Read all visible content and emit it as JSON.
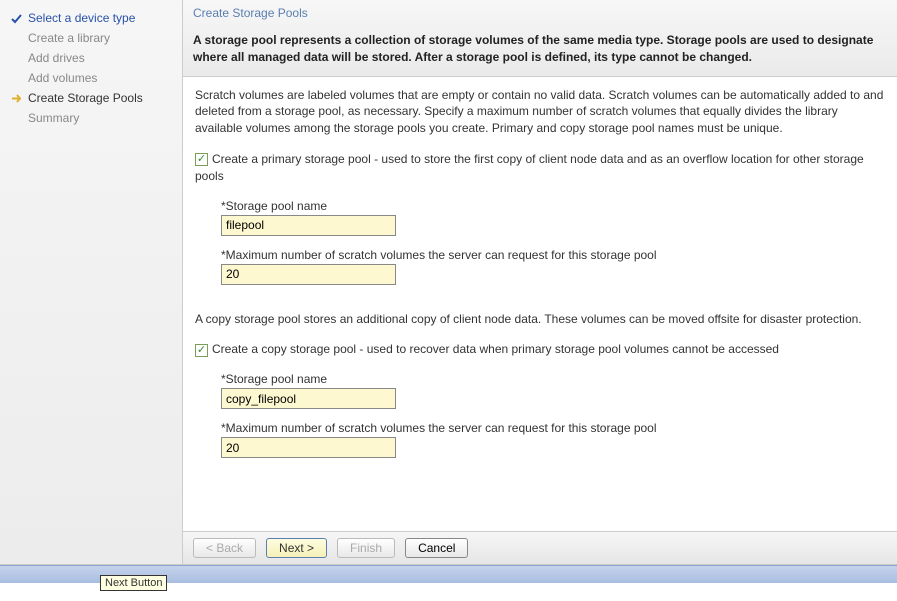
{
  "sidebar": {
    "items": [
      {
        "label": "Select a device type",
        "state": "done"
      },
      {
        "label": "Create a library",
        "state": "pending"
      },
      {
        "label": "Add drives",
        "state": "pending"
      },
      {
        "label": "Add volumes",
        "state": "pending"
      },
      {
        "label": "Create Storage Pools",
        "state": "current"
      },
      {
        "label": "Summary",
        "state": "pending"
      }
    ]
  },
  "header": {
    "title": "Create Storage Pools",
    "description": "A storage pool represents a collection of storage volumes of the same media type. Storage pools are used to designate where all managed data will be stored. After a storage pool is defined, its type cannot be changed."
  },
  "content": {
    "scratch_paragraph": "Scratch volumes are labeled volumes that are empty or contain no valid data. Scratch volumes can be automatically added to and deleted from a storage pool, as necessary. Specify a maximum number of scratch volumes that equally divides the library available volumes among the storage pools you create. Primary and copy storage pool names must be unique.",
    "primary": {
      "checkbox_label": "Create a primary storage pool - used to store the first copy of client node data and as an overflow location for other storage pools",
      "pool_name_label": "Storage pool name",
      "pool_name_value": "filepool",
      "max_label": "Maximum number of scratch volumes the server can request for this storage pool",
      "max_value": "20"
    },
    "copy_paragraph": "A copy storage pool stores an additional copy of client node data. These volumes can be moved offsite for disaster protection.",
    "copy": {
      "checkbox_label": "Create a copy storage pool - used to recover data when primary storage pool volumes cannot be accessed",
      "pool_name_label": "Storage pool name",
      "pool_name_value": "copy_filepool",
      "max_label": "Maximum number of scratch volumes the server can request for this storage pool",
      "max_value": "20"
    }
  },
  "buttons": {
    "back": "< Back",
    "next": "Next >",
    "finish": "Finish",
    "cancel": "Cancel"
  },
  "tooltip": "Next Button"
}
